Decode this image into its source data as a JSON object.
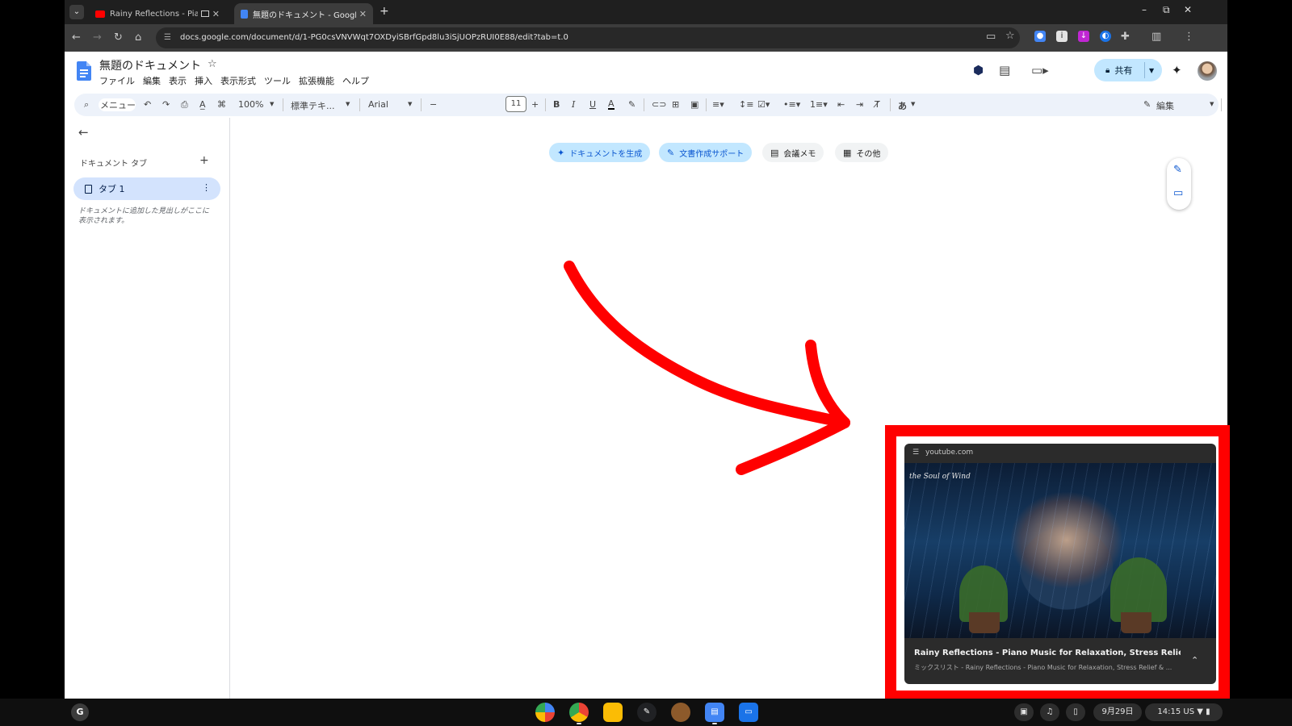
{
  "browser": {
    "tabs": [
      {
        "title": "Rainy Reflections - Piano",
        "active": false
      },
      {
        "title": "無題のドキュメント - Google",
        "active": true
      }
    ],
    "new_tab": "+",
    "url": "docs.google.com/document/d/1-PG0csVNVWqt7OXDyiSBrfGpd8lu3iSjUOPzRUI0E88/edit?tab=t.0",
    "window_controls": {
      "minimize": "–",
      "restore": "⧉",
      "close": "✕"
    }
  },
  "docs": {
    "title": "無題のドキュメント",
    "menu": [
      "ファイル",
      "編集",
      "表示",
      "挿入",
      "表示形式",
      "ツール",
      "拡張機能",
      "ヘルプ"
    ],
    "share_label": "共有",
    "toolbar": {
      "search": "メニュー",
      "zoom": "100%",
      "style": "標準テキ...",
      "font": "Arial",
      "font_size": "11",
      "input_mode": "あ",
      "mode": "編集"
    },
    "tabs_panel": {
      "heading": "ドキュメント タブ",
      "tab_label": "タブ 1",
      "hint": "ドキュメントに追加した見出しがここに表示されます。"
    },
    "chips": [
      "ドキュメントを生成",
      "文書作成サポート",
      "会議メモ",
      "その他"
    ]
  },
  "mini_player": {
    "domain": "youtube.com",
    "watermark": "the Soul of Wind",
    "title": "Rainy Reflections - Piano Music for Relaxation, Stress Relief & Pea...",
    "subtitle": "ミックスリスト - Rainy Reflections - Piano Music for Relaxation, Stress Relief & ...",
    "progress_fraction": 0.2
  },
  "shelf": {
    "launcher": "G",
    "date": "9月29日",
    "time": "14:15",
    "locale": "US"
  },
  "colors": {
    "annotation_red": "#ff0000",
    "docs_blue": "#4285f4",
    "chip_blue": "#c2e7ff"
  }
}
